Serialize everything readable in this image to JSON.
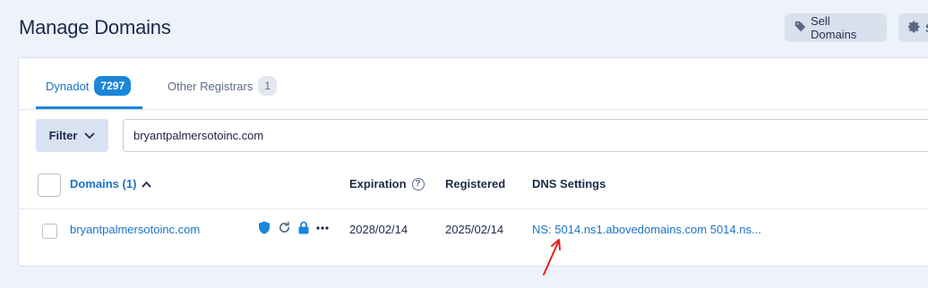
{
  "header": {
    "title": "Manage Domains",
    "sell_label": "Sell Domains",
    "settings_label": "S"
  },
  "tabs": [
    {
      "label": "Dynadot",
      "count": "7297"
    },
    {
      "label": "Other Registrars",
      "count": "1"
    }
  ],
  "filter": {
    "label": "Filter"
  },
  "search": {
    "value": "bryantpalmersotoinc.com"
  },
  "table": {
    "columns": {
      "domains": "Domains (1)",
      "expiration": "Expiration",
      "registered": "Registered",
      "dns": "DNS Settings"
    },
    "rows": [
      {
        "domain": "bryantpalmersotoinc.com",
        "expiration": "2028/02/14",
        "registered": "2025/02/14",
        "dns": "NS: 5014.ns1.abovedomains.com 5014.ns..."
      }
    ]
  },
  "icons": {
    "tag": "tag-icon",
    "gear": "gear-icon",
    "chevron": "chevron-down-icon",
    "sort": "sort-up-icon",
    "help": "question-circle-icon",
    "shield": "shield-icon",
    "renew": "refresh-icon",
    "lock": "lock-icon",
    "more": "more-icon"
  },
  "colors": {
    "accent": "#1a86d9",
    "link": "#1a73c8",
    "annotation_arrow": "#e0201c"
  }
}
